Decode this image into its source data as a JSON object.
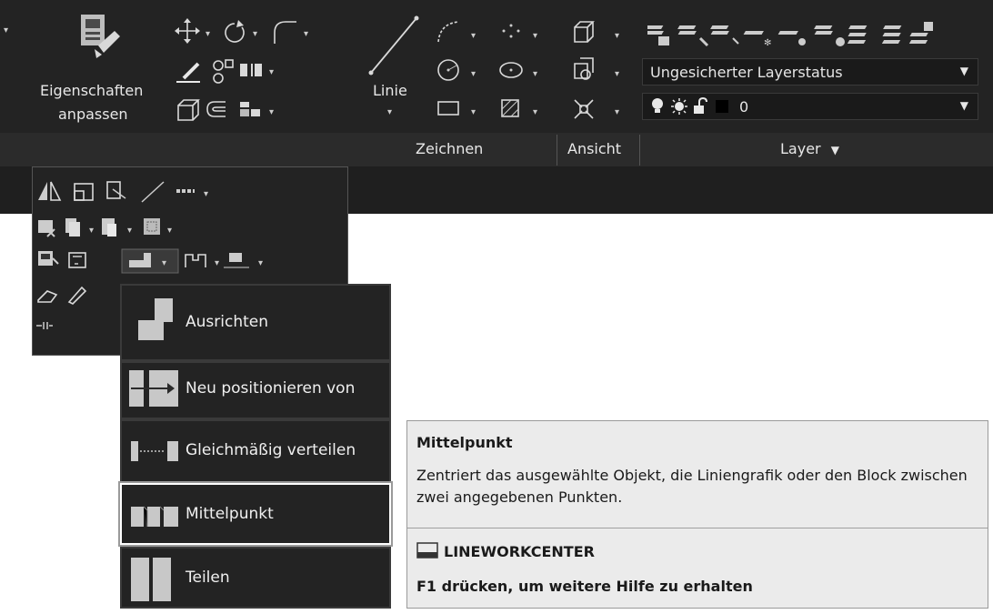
{
  "ribbon": {
    "properties_button": {
      "label_line1": "Eigenschaften",
      "label_line2": "anpassen"
    },
    "line_button": {
      "label": "Linie"
    },
    "groups": {
      "draw": "Zeichnen",
      "view": "Ansicht",
      "layer": "Layer"
    },
    "layer_state": "Ungesicherter Layerstatus",
    "current_layer": "0"
  },
  "flyout": {
    "items": [
      {
        "label": "Ausrichten"
      },
      {
        "label": "Neu positionieren von"
      },
      {
        "label": "Gleichmäßig verteilen"
      },
      {
        "label": "Mittelpunkt"
      },
      {
        "label": "Teilen"
      }
    ]
  },
  "tooltip": {
    "title": "Mittelpunkt",
    "description": "Zentriert das ausgewählte Objekt, die Liniengrafik oder den Block zwischen zwei angegebenen Punkten.",
    "command": "LINEWORKCENTER",
    "help": "F1 drücken, um weitere Hilfe zu erhalten"
  },
  "colors": {
    "ribbon_bg": "#232323",
    "tooltip_bg": "#ebebeb",
    "highlight_border": "#ffffff"
  }
}
